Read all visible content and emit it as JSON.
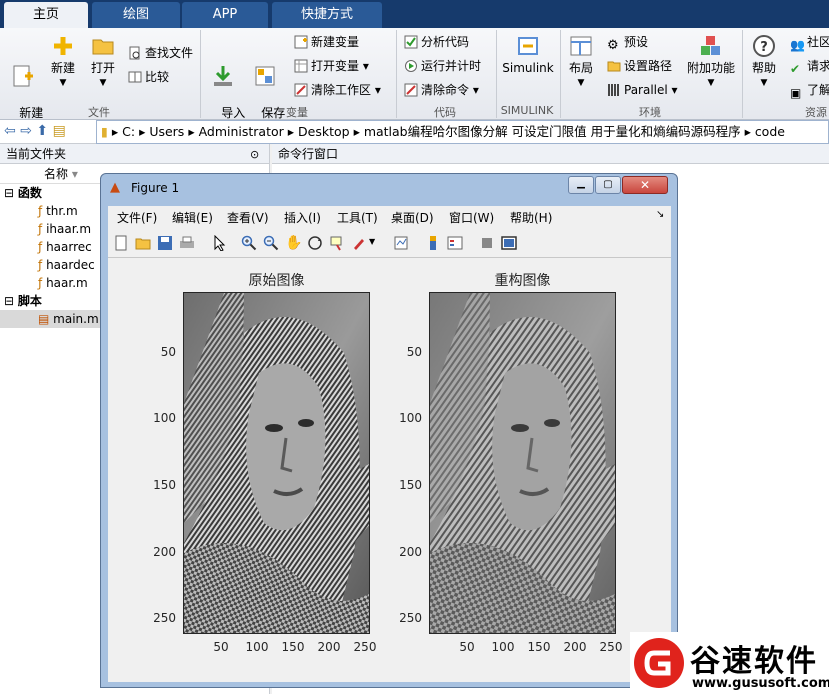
{
  "tabs": [
    {
      "label": "主页"
    },
    {
      "label": "绘图"
    },
    {
      "label": "APP"
    },
    {
      "label": "快捷方式"
    }
  ],
  "ribbon": {
    "new_script": "新建\n脚本",
    "new": "新建",
    "open": "打开",
    "find_files": "查找文件",
    "compare": "比较",
    "import_data": "导入\n数据",
    "save_workspace": "保存\n工作区",
    "new_variable": "新建变量",
    "open_variable": "打开变量",
    "clear_workspace": "清除工作区",
    "analyze_code": "分析代码",
    "run_and_time": "运行并计时",
    "clear_commands": "清除命令",
    "simulink": "Simulink",
    "layout": "布局",
    "preferences": "预设",
    "set_path": "设置路径",
    "parallel": "Parallel",
    "addons": "附加功能",
    "help": "帮助",
    "community": "社区",
    "request_support": "请求",
    "learn": "了解",
    "groups": {
      "file": "文件",
      "variable": "变量",
      "code": "代码",
      "simulink": "SIMULINK",
      "environment": "环境",
      "resources": "资源"
    }
  },
  "address": {
    "segments": [
      "C:",
      "Users",
      "Administrator",
      "Desktop",
      "matlab编程哈尔图像分解 可设定门限值 用于量化和熵编码源码程序",
      "code"
    ]
  },
  "current_folder": {
    "title": "当前文件夹",
    "column": "名称",
    "groups": [
      {
        "label": "函数",
        "files": [
          "thr.m",
          "ihaar.m",
          "haarrec",
          "haardec",
          "haar.m"
        ]
      },
      {
        "label": "脚本",
        "files": [
          "main.m"
        ]
      }
    ]
  },
  "command_window": {
    "title": "命令行窗口"
  },
  "figure": {
    "title": "Figure 1",
    "menu": [
      "文件(F)",
      "编辑(E)",
      "查看(V)",
      "插入(I)",
      "工具(T)",
      "桌面(D)",
      "窗口(W)",
      "帮助(H)"
    ],
    "axes": [
      {
        "title": "原始图像",
        "yticks": [
          "50",
          "100",
          "150",
          "200",
          "250"
        ],
        "xticks": [
          "50",
          "100",
          "150",
          "200",
          "250"
        ]
      },
      {
        "title": "重构图像",
        "yticks": [
          "50",
          "100",
          "150",
          "200",
          "250"
        ],
        "xticks": [
          "50",
          "100",
          "150",
          "200",
          "250"
        ]
      }
    ]
  },
  "watermark": {
    "brand": "谷速软件",
    "url": "www.gususoft.com"
  },
  "colors": {
    "titlebar": "#163a6c",
    "accent": "#2a5a97",
    "figure_frame": "#a7c1e0",
    "close": "#c9463d"
  }
}
